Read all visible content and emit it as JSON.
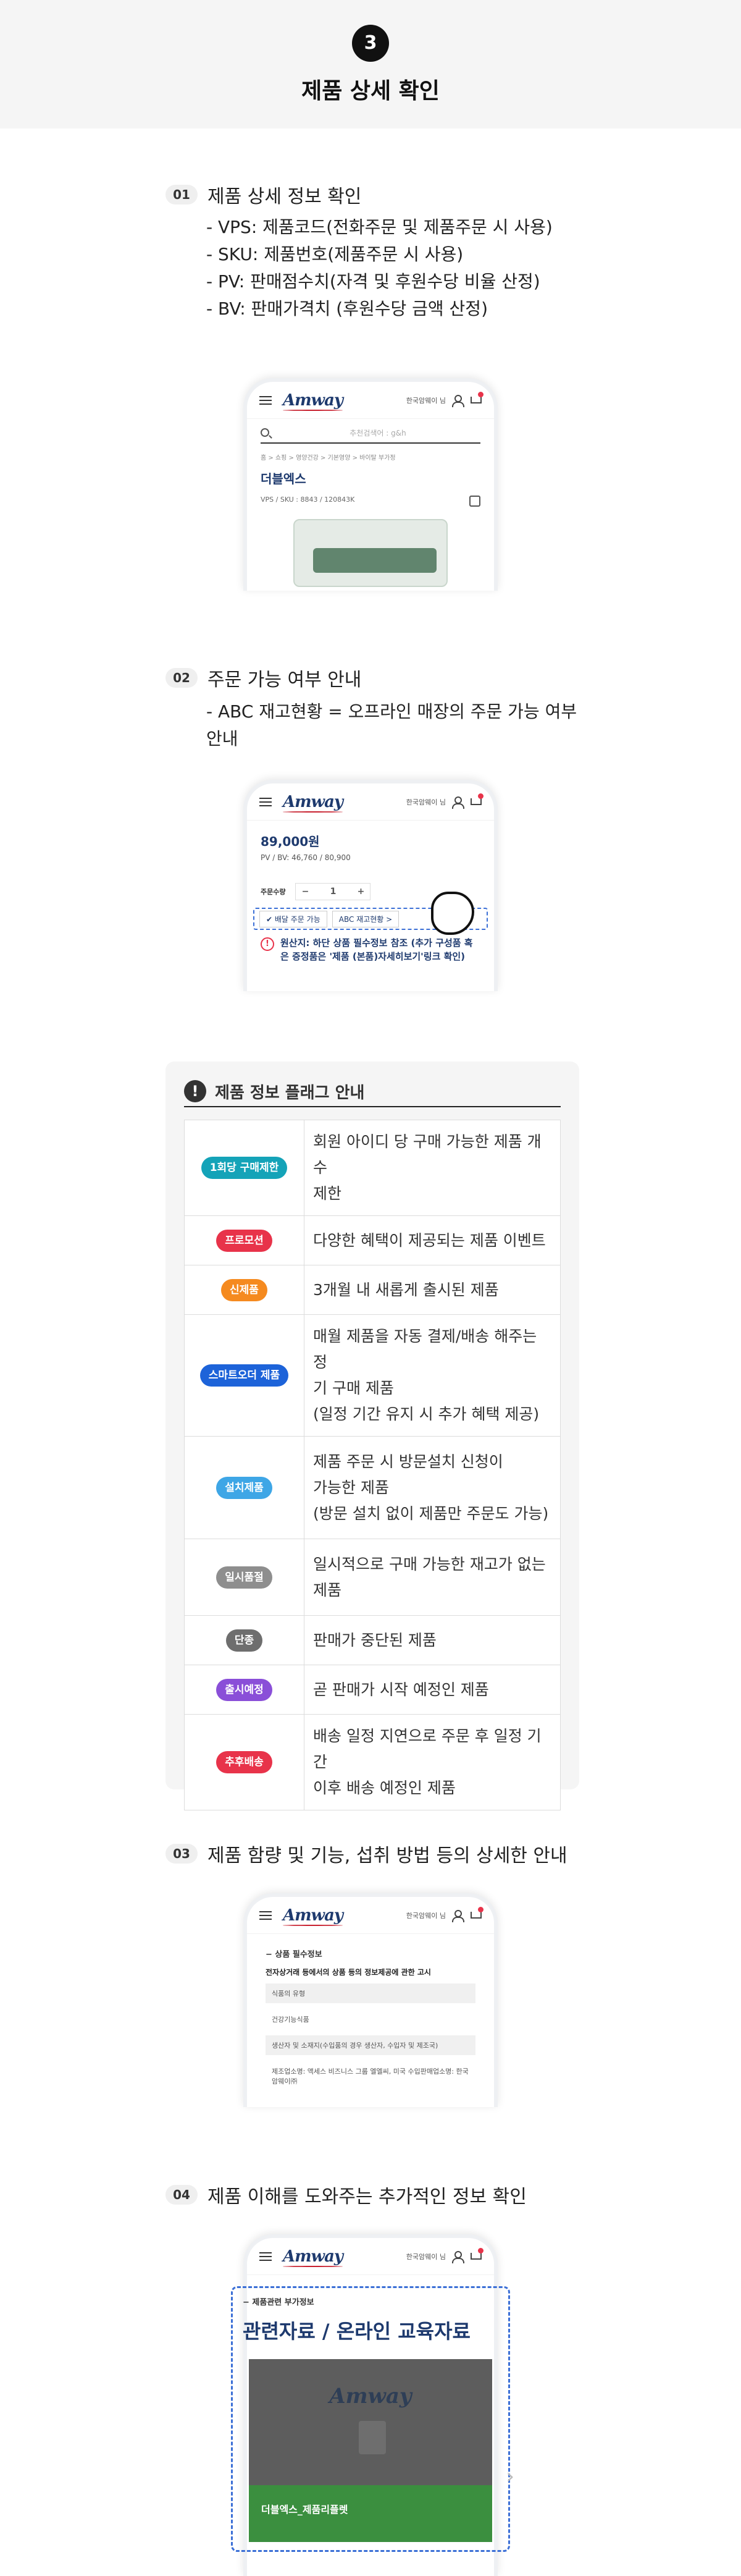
{
  "header": {
    "step": "3",
    "title": "제품 상세 확인"
  },
  "sections": [
    {
      "num": "01",
      "title": "제품 상세 정보 확인",
      "bullets": [
        "- VPS: 제품코드(전화주문 및 제품주문 시 사용)",
        "- SKU: 제품번호(제품주문 시 사용)",
        "- PV: 판매점수치(자격 및 후원수당 비율 산정)",
        "- BV: 판매가격치 (후원수당 금액 산정)"
      ]
    },
    {
      "num": "02",
      "title": "주문 가능 여부 안내",
      "bullets": [
        "- ABC 재고현황 = 오프라인 매장의 주문 가능 여부 안내"
      ]
    },
    {
      "num": "03",
      "title": "제품 함량 및 기능, 섭취 방법 등의 상세한 안내"
    },
    {
      "num": "04",
      "title": "제품 이해를 도와주는 추가적인 정보 확인"
    }
  ],
  "phone": {
    "logo": "Amway",
    "lang": "한국암웨이 님",
    "search_placeholder": "추천검색어 : g&h",
    "breadcrumb": "홈 > 쇼핑 > 영양건강 > 기본영양 > 바이탈 부가정",
    "product_name": "더블엑스",
    "product_code": "VPS / SKU : 8843 / 120843K",
    "price": "89,000원",
    "pv_bv": "PV / BV: 46,760 / 80,900",
    "qty_label": "주문수량",
    "qty_minus": "−",
    "qty_value": "1",
    "qty_plus": "+",
    "chip_delivery": "✔ 배달 주문 가능",
    "chip_abc": "ABC 재고현황 >",
    "notice": "원산지: 하단 상품 필수정보 참조 (추가 구성품 혹은 증정품은 '제품 (본품)자세히보기'링크 확인)",
    "notice_icon": "!",
    "info_head": "−   상품 필수정보",
    "info_sub": "전자상거래 등에서의 상품 등의 정보제공에 관한 고시",
    "info_rows": [
      "식품의 유형",
      "건강기능식품",
      "생산자 및 소재지(수입품의 경우 생산자, 수입자 및 제조국)",
      "제조업소명: 액세스 비즈니스 그룹 엘엘씨, 미국 수입판매업소명: 한국암웨이㈜"
    ],
    "rel_small": "−   제품관련 부가정보",
    "rel_title": "관련자료 / 온라인 교육자료",
    "card_logo": "Amway",
    "card_caption": "더블엑스_제품리플렛",
    "chevron": "›"
  },
  "flags": {
    "icon": "!",
    "title": "제품 정보 플래그 안내",
    "rows": [
      {
        "badge": "1회당 구매제한",
        "color": "#14a3b8",
        "desc": [
          "회원 아이디 당 구매 가능한 제품 개수",
          "제한"
        ]
      },
      {
        "badge": "프로모션",
        "color": "#e8334a",
        "desc": [
          "다양한 혜택이 제공되는 제품 이벤트"
        ]
      },
      {
        "badge": "신제품",
        "color": "#f58a1f",
        "desc": [
          "3개월 내 새롭게 출시된 제품"
        ]
      },
      {
        "badge": "스마트오더 제품",
        "color": "#1d63d9",
        "desc": [
          "매월 제품을 자동 결제/배송 해주는 정",
          "기 구매 제품",
          "(일정 기간 유지 시 추가 혜택 제공)"
        ]
      },
      {
        "badge": "설치제품",
        "color": "#3ea6e6",
        "desc": [
          "제품 주문 시 방문설치 신청이",
          "가능한 제품",
          "(방문 설치 없이 제품만 주문도 가능)"
        ]
      },
      {
        "badge": "일시품절",
        "color": "#8e8e8e",
        "desc": [
          "일시적으로 구매 가능한 재고가 없는",
          "제품"
        ]
      },
      {
        "badge": "단종",
        "color": "#6e6e6e",
        "desc": [
          "판매가 중단된 제품"
        ]
      },
      {
        "badge": "출시예정",
        "color": "#8a4fd8",
        "desc": [
          "곧 판매가 시작 예정인 제품"
        ]
      },
      {
        "badge": "추후배송",
        "color": "#e8334a",
        "desc": [
          "배송 일정 지연으로 주문 후 일정 기간",
          "이후 배송 예정인 제품"
        ]
      }
    ]
  }
}
